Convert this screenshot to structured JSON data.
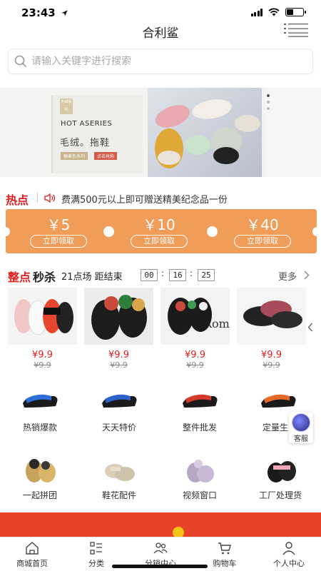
{
  "status_bar": {
    "time": "23:43"
  },
  "header": {
    "title": "合利鲨"
  },
  "search": {
    "placeholder": "请输入关键字进行搜索"
  },
  "banner": {
    "tag": "毛绒系列",
    "series": "HOT ASERIES",
    "headline": "毛绒。拖鞋",
    "sub_left": "糖果色系列",
    "sub_right": "点击抢购"
  },
  "hot_notice": {
    "title": "热点",
    "text": "费满500元以上即可赠送精美纪念品一份"
  },
  "coupons": [
    {
      "amount": "￥5",
      "button": "立即领取"
    },
    {
      "amount": "￥10",
      "button": "立即领取"
    },
    {
      "amount": "￥40",
      "button": "立即领取"
    }
  ],
  "flash_sale": {
    "title_red": "整点",
    "title_black": "秒杀",
    "session": "21点场 距结束",
    "timer": [
      "00",
      "16",
      "25"
    ],
    "more": "更多",
    "items": [
      {
        "price": "¥9.9",
        "old_price": "¥9.9"
      },
      {
        "price": "¥9.9",
        "old_price": "¥9.9"
      },
      {
        "price": "¥9.9",
        "old_price": "¥9.9"
      },
      {
        "price": "¥9.9",
        "old_price": "¥9.9"
      }
    ]
  },
  "categories": [
    {
      "label": "热销爆款"
    },
    {
      "label": "天天特价"
    },
    {
      "label": "整件批发"
    },
    {
      "label": "定量生"
    },
    {
      "label": "一起拼团"
    },
    {
      "label": "鞋花配件"
    },
    {
      "label": "视频窗口"
    },
    {
      "label": "工厂处理货"
    }
  ],
  "service": {
    "label": "客服"
  },
  "tab_bar": [
    {
      "label": "商城首页",
      "icon": "home-icon"
    },
    {
      "label": "分类",
      "icon": "category-icon"
    },
    {
      "label": "分销中心",
      "icon": "distribution-icon"
    },
    {
      "label": "购物车",
      "icon": "cart-icon"
    },
    {
      "label": "个人中心",
      "icon": "user-icon"
    }
  ],
  "colors": {
    "accent_red": "#e21d1d",
    "coupon_orange": "#f19d5a",
    "promo_red": "#e8432a"
  }
}
